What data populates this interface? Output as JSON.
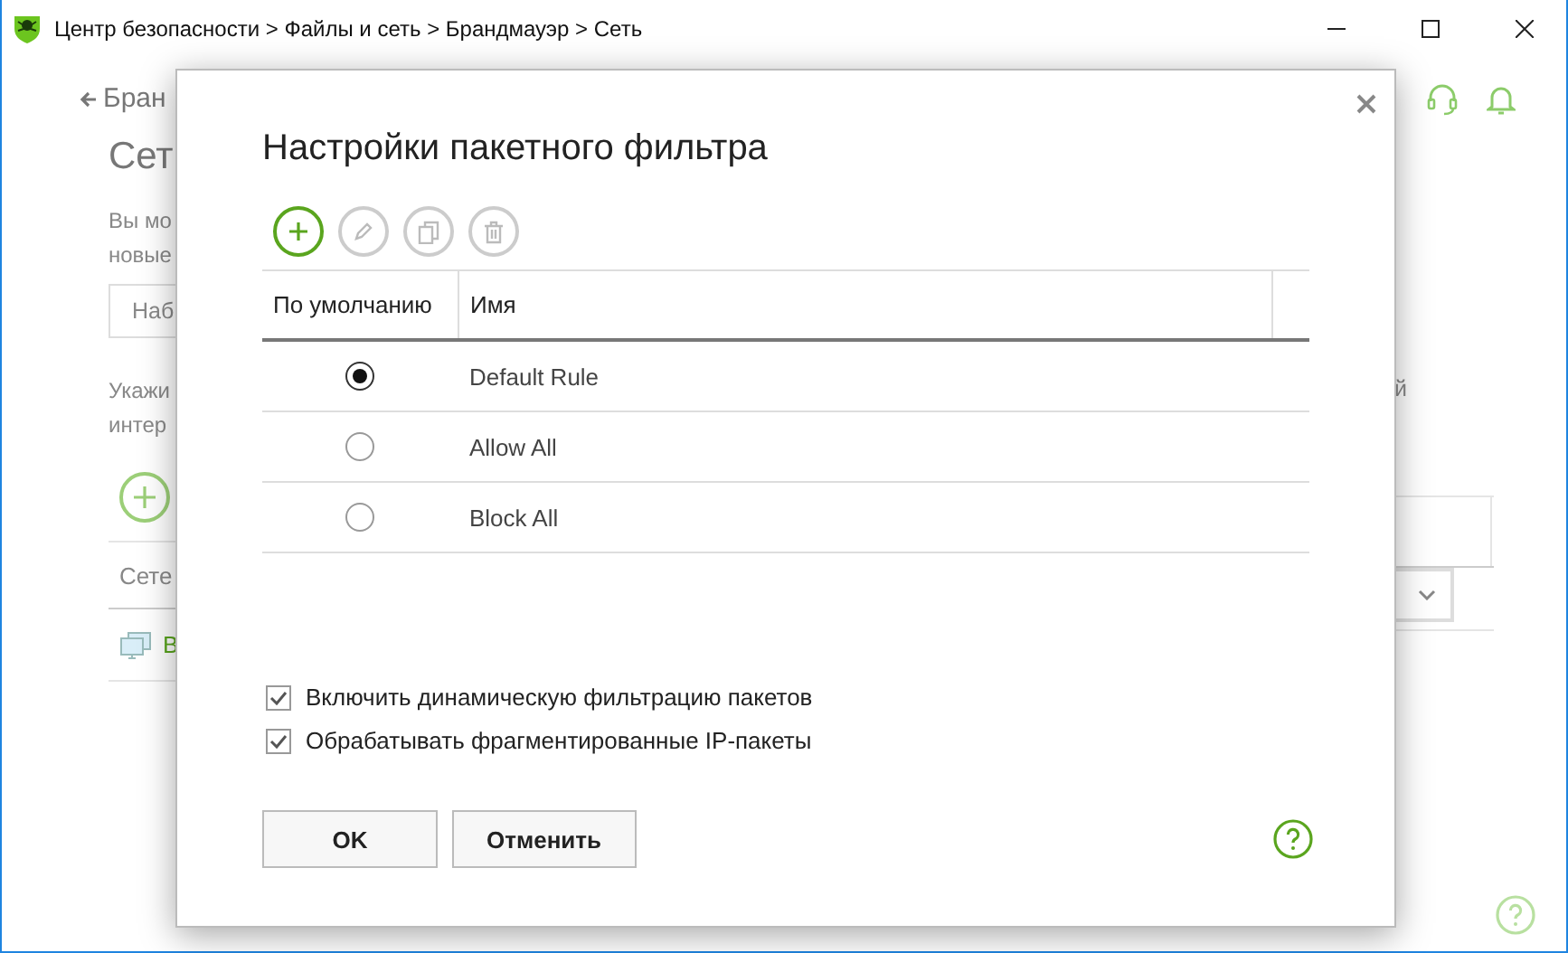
{
  "window": {
    "breadcrumb": "Центр безопасности > Файлы и сеть > Брандмауэр > Сеть"
  },
  "background": {
    "back_link": "Бран",
    "heading": "Сет",
    "paragraph_1": [
      "Вы мо",
      "новые"
    ],
    "button": "Наб",
    "paragraph_2": [
      "Укажи",
      "интер"
    ],
    "right_fragment": "й",
    "table_header": "Сете",
    "row_label": "В"
  },
  "dialog": {
    "title": "Настройки пакетного фильтра",
    "toolbar": [
      {
        "kind": "add",
        "disabled": false
      },
      {
        "kind": "edit",
        "disabled": true
      },
      {
        "kind": "copy",
        "disabled": true
      },
      {
        "kind": "delete",
        "disabled": true
      }
    ],
    "columns": [
      "По умолчанию",
      "Имя"
    ],
    "rows": [
      {
        "name": "Default Rule",
        "selected": true
      },
      {
        "name": "Allow All",
        "selected": false
      },
      {
        "name": "Block All",
        "selected": false
      }
    ],
    "options": [
      {
        "label": "Включить динамическую фильтрацию пакетов",
        "checked": true
      },
      {
        "label": "Обрабатывать фрагментированные IP-пакеты",
        "checked": true
      }
    ],
    "buttons": [
      "OK",
      "Отменить"
    ]
  }
}
